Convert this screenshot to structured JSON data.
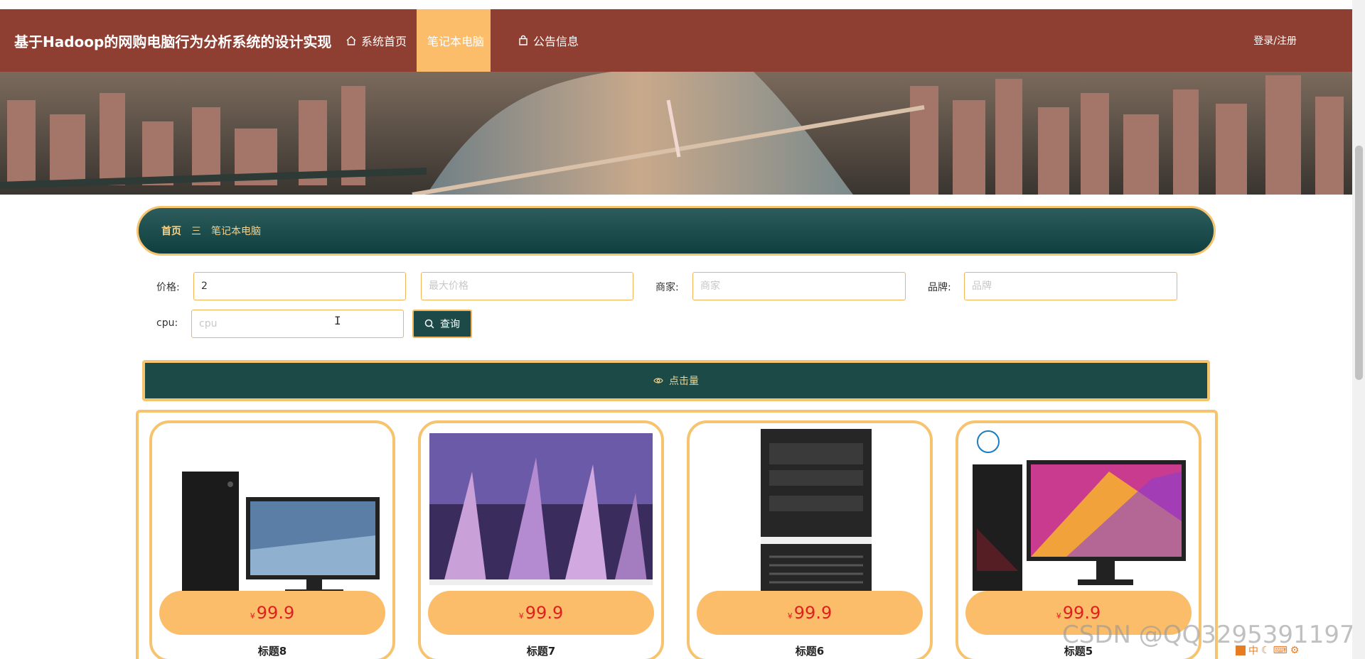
{
  "header": {
    "title": "基于Hadoop的网购电脑行为分析系统的设计实现",
    "nav": [
      {
        "label": "系统首页",
        "icon": "home-icon"
      },
      {
        "label": "笔记本电脑",
        "icon": "star-icon"
      },
      {
        "label": "公告信息",
        "icon": "bag-icon"
      }
    ],
    "login_label": "登录/注册"
  },
  "breadcrumb": {
    "home": "首页",
    "separator": "三",
    "current": "笔记本电脑"
  },
  "filters": {
    "price_label": "价格:",
    "min_price_value": "2",
    "max_price_placeholder": "最大价格",
    "merchant_label": "商家:",
    "merchant_placeholder": "商家",
    "brand_label": "品牌:",
    "brand_placeholder": "品牌",
    "cpu_label": "cpu:",
    "cpu_placeholder": "cpu",
    "search_label": "查询"
  },
  "sort_bar": {
    "label": "点击量",
    "icon": "eye-icon"
  },
  "products": [
    {
      "title": "标题8",
      "currency": "¥",
      "price": "99.9",
      "image": "desktop-tower-with-monitor"
    },
    {
      "title": "标题7",
      "currency": "¥",
      "price": "99.9",
      "image": "gaming-monitor-artwork"
    },
    {
      "title": "标题6",
      "currency": "¥",
      "price": "99.9",
      "image": "desktop-tower"
    },
    {
      "title": "标题5",
      "currency": "¥",
      "price": "99.9",
      "image": "dell-desktop-with-monitor"
    }
  ],
  "overlay": {
    "watermark": "CSDN @QQ3295391197",
    "ime_mode": "中"
  },
  "colors": {
    "nav_bg": "#8e3f32",
    "accent": "#fbbd69",
    "teal": "#1b4a47",
    "price": "#e02020"
  }
}
